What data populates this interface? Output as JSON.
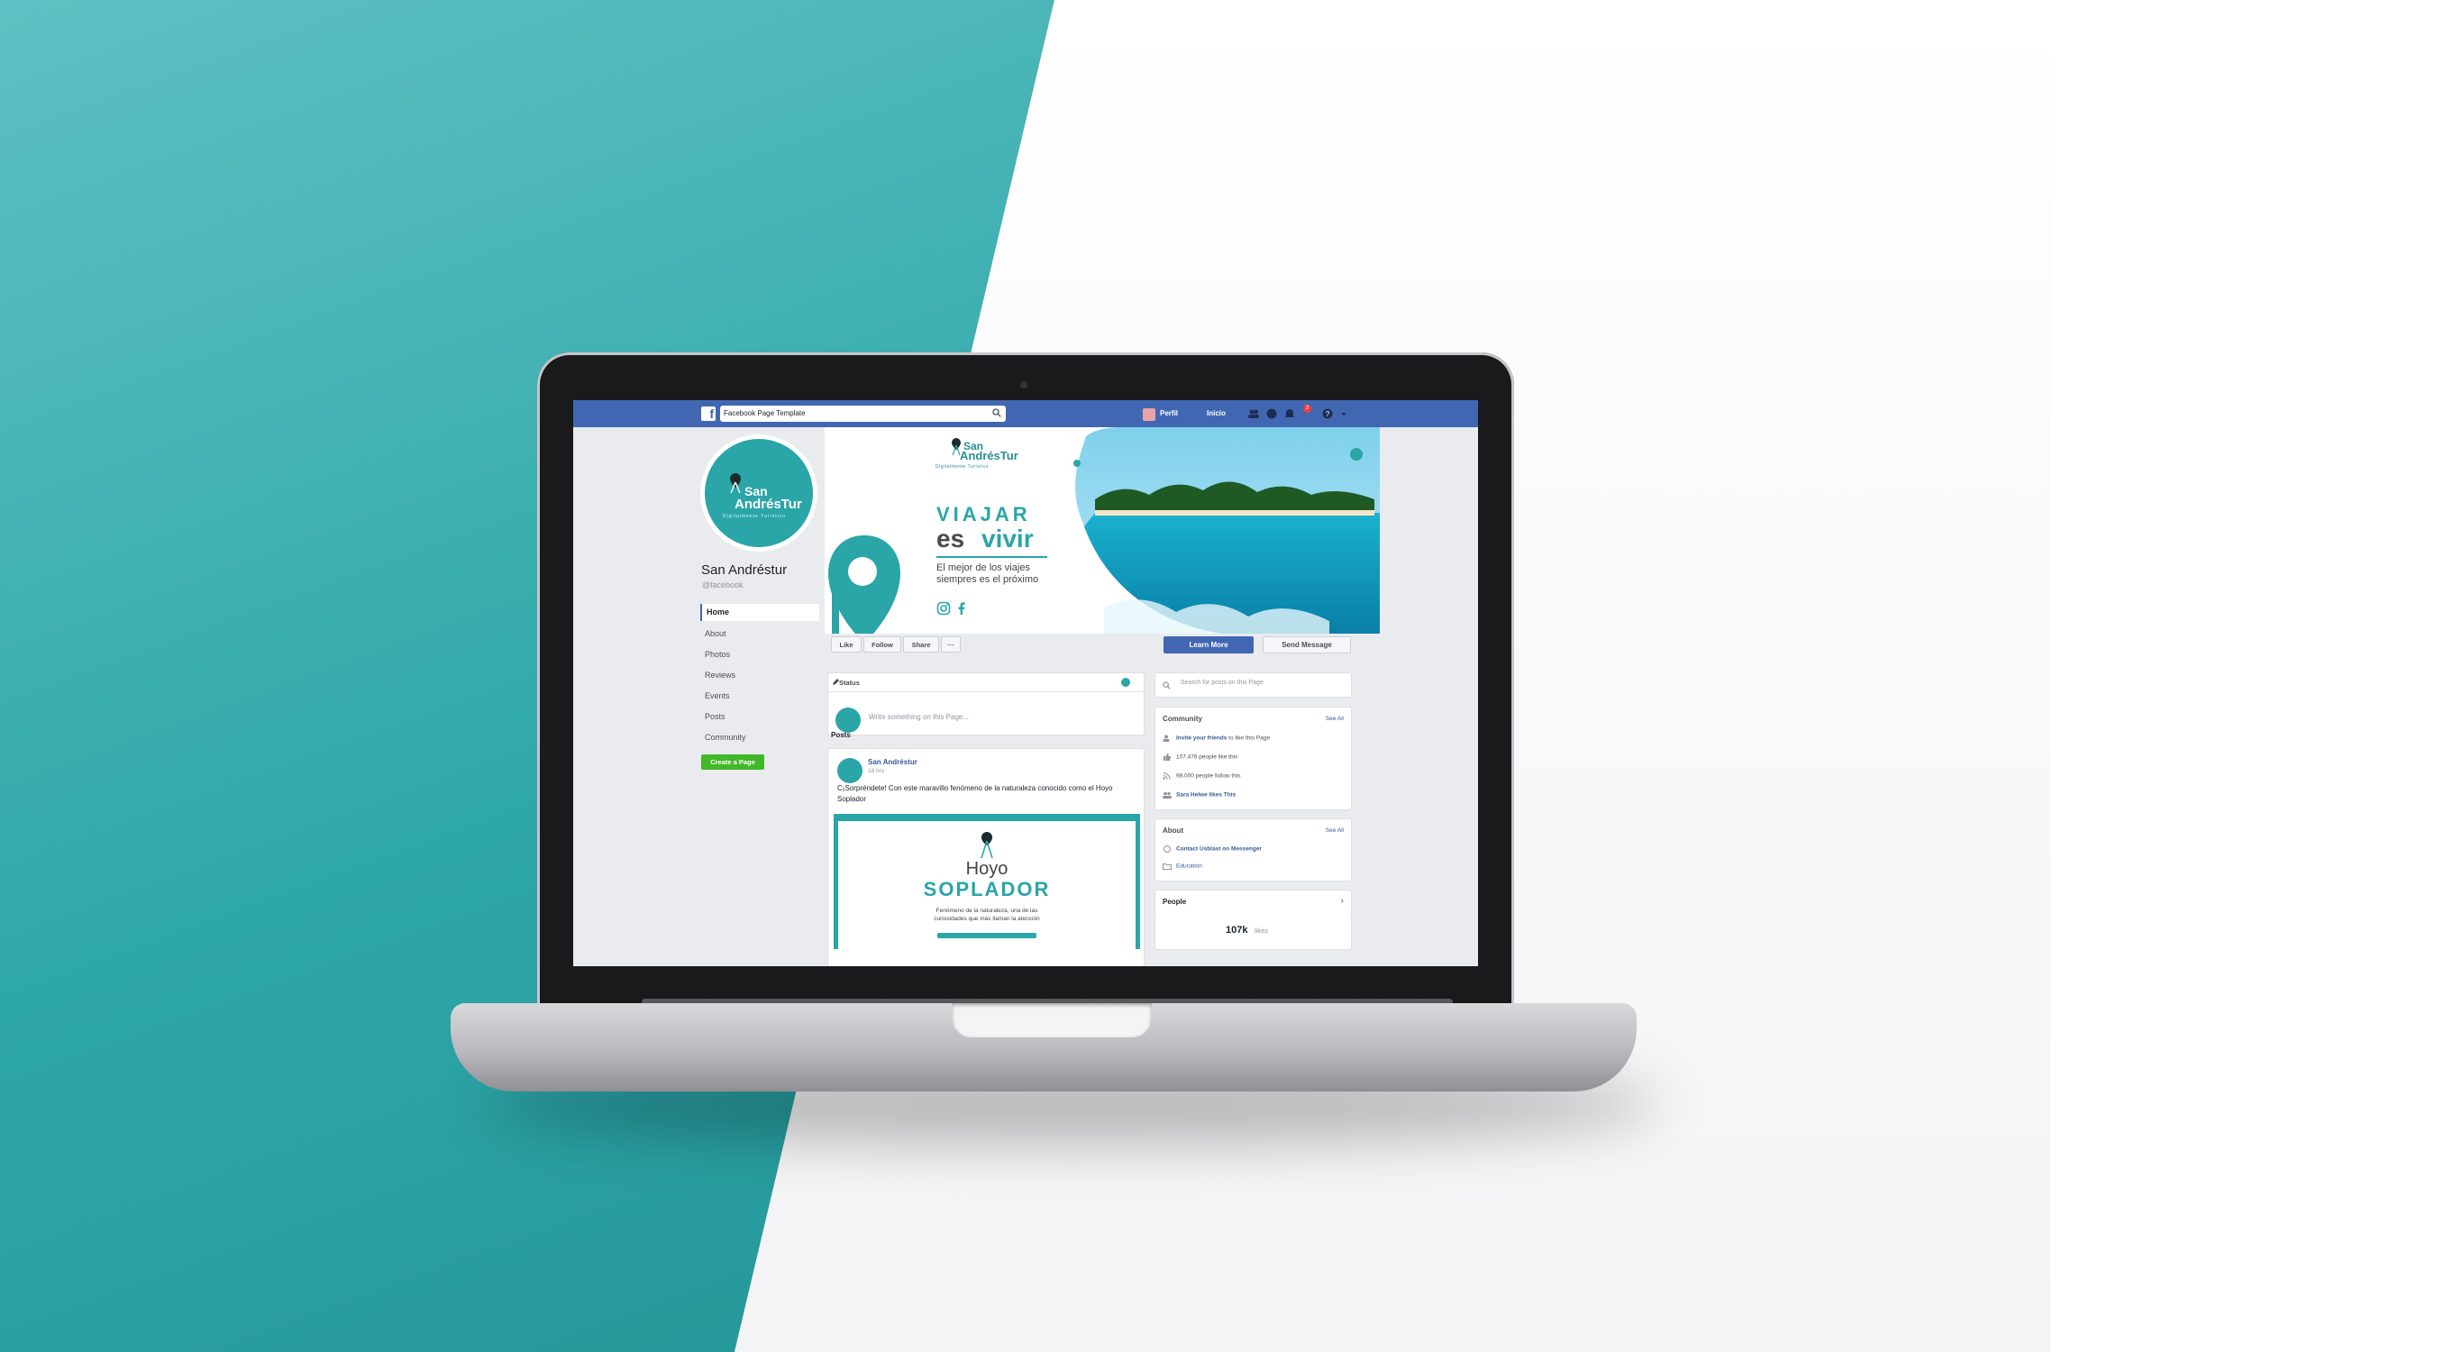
{
  "topbar": {
    "logo": "f",
    "search_value": "Facebook Page Template",
    "profile_label": "Perfil",
    "home_label": "Inicio",
    "notification_count": "2",
    "brand_color": "#4267b2"
  },
  "page": {
    "profile_name_line1": "San",
    "profile_name_line2": "AndrésTur",
    "profile_tagline": "Digitalmente Turístico",
    "name": "San Andréstur",
    "handle": "@facebook"
  },
  "nav": {
    "items": [
      "Home",
      "About",
      "Photos",
      "Reviews",
      "Events",
      "Posts",
      "Community"
    ],
    "create_page": "Create a Page"
  },
  "cover": {
    "logo_line1": "San",
    "logo_line2": "AndrésTur",
    "logo_tagline": "Digitalmente Turístico",
    "headline1": "VIAJAR",
    "headline2a": "es",
    "headline2b": "vivir",
    "sub1": "El mejor de los viajes",
    "sub2": "siempres es el próximo",
    "accent_color": "#2aa5a8"
  },
  "actions": {
    "like": "Like",
    "follow": "Follow",
    "share": "Share",
    "more": "···",
    "learn_more": "Learn More",
    "send_message": "Send Message"
  },
  "composer": {
    "status_label": "Status",
    "placeholder": "Write something on this Page..."
  },
  "posts": {
    "heading": "Posts",
    "author": "San Andréstur",
    "time": "18 hrs",
    "text": "C¡Sorpréndete! Con este maravillo fenómeno de la naturaleza conocido como el Hoyo Soplador",
    "image_title1": "Hoyo",
    "image_title2": "SOPLADOR",
    "image_caption1": "Fenómeno de la naturaleza, una de las",
    "image_caption2": "curiosidades que más llaman la atención"
  },
  "sidebar": {
    "search_placeholder": "Search for posts on this Page",
    "community": {
      "title": "Community",
      "see_all": "See All",
      "invite_link": "Invite your friends",
      "invite_rest": " to like this Page",
      "likes": "107,476 people like this",
      "follows": "98,000 people follow this",
      "friend_like": "Sara Helwe likes This"
    },
    "about": {
      "title": "About",
      "see_all": "See All",
      "contact": "Contact Usblast on Messenger",
      "category": "Education"
    },
    "people": {
      "title": "People",
      "chevron": "›",
      "likes_count": "107k",
      "likes_label": "likes"
    }
  }
}
